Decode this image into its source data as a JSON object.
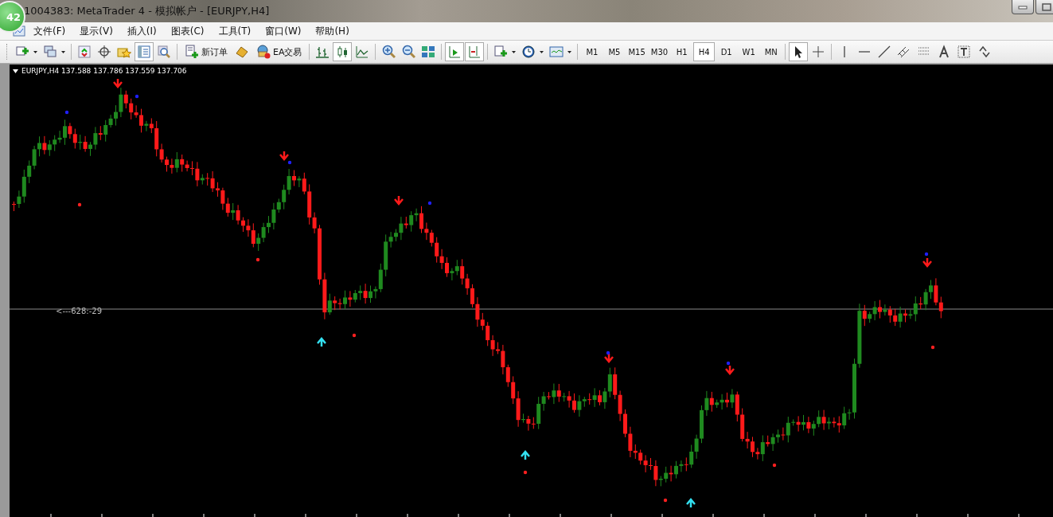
{
  "window": {
    "title": "1004383: MetaTrader 4 - 模拟帐户 - [EURJPY,H4]",
    "badge": "42"
  },
  "menu": [
    "文件(F)",
    "显示(V)",
    "插入(I)",
    "图表(C)",
    "工具(T)",
    "窗口(W)",
    "帮助(H)"
  ],
  "toolbar": [
    {
      "kind": "icon",
      "pressed": false
    },
    {
      "kind": "icon",
      "pressed": false
    },
    {
      "kind": "sep"
    },
    {
      "kind": "icon",
      "pressed": false
    },
    {
      "kind": "icon",
      "pressed": false
    },
    {
      "kind": "icon",
      "pressed": false
    },
    {
      "kind": "icon",
      "pressed": true
    },
    {
      "kind": "icon",
      "pressed": false
    },
    {
      "kind": "sep"
    },
    {
      "kind": "labeled",
      "label": "新订单"
    },
    {
      "kind": "icon",
      "pressed": false
    },
    {
      "kind": "labeled",
      "label": "EA交易"
    },
    {
      "kind": "sep"
    },
    {
      "kind": "icon",
      "pressed": false
    },
    {
      "kind": "icon",
      "pressed": true
    },
    {
      "kind": "icon",
      "pressed": false
    },
    {
      "kind": "sep"
    },
    {
      "kind": "icon",
      "pressed": false
    },
    {
      "kind": "icon",
      "pressed": false
    },
    {
      "kind": "icon",
      "pressed": false
    },
    {
      "kind": "sep"
    },
    {
      "kind": "icon",
      "pressed": true
    },
    {
      "kind": "icon",
      "pressed": true
    },
    {
      "kind": "sep"
    },
    {
      "kind": "icon",
      "pressed": false
    },
    {
      "kind": "icon",
      "pressed": false
    },
    {
      "kind": "icon",
      "pressed": false
    },
    {
      "kind": "sep"
    },
    {
      "kind": "timeframe",
      "label": "M1",
      "selected": false
    },
    {
      "kind": "timeframe",
      "label": "M5",
      "selected": false
    },
    {
      "kind": "timeframe",
      "label": "M15",
      "selected": false
    },
    {
      "kind": "timeframe",
      "label": "M30",
      "selected": false
    },
    {
      "kind": "timeframe",
      "label": "H1",
      "selected": false
    },
    {
      "kind": "timeframe",
      "label": "H4",
      "selected": true
    },
    {
      "kind": "timeframe",
      "label": "D1",
      "selected": false
    },
    {
      "kind": "timeframe",
      "label": "W1",
      "selected": false
    },
    {
      "kind": "timeframe",
      "label": "MN",
      "selected": false
    },
    {
      "kind": "sep"
    },
    {
      "kind": "icon",
      "pressed": true
    },
    {
      "kind": "icon",
      "pressed": false
    },
    {
      "kind": "sep"
    },
    {
      "kind": "icon",
      "pressed": false
    },
    {
      "kind": "icon",
      "pressed": false
    },
    {
      "kind": "icon",
      "pressed": false
    },
    {
      "kind": "icon",
      "pressed": false
    },
    {
      "kind": "icon",
      "pressed": false
    },
    {
      "kind": "icon",
      "pressed": false
    },
    {
      "kind": "icon",
      "pressed": false
    },
    {
      "kind": "icon",
      "pressed": false
    }
  ],
  "chart": {
    "header": "EURJPY,H4 137.588 137.786 137.559 137.706",
    "line_label": "<---628:-29"
  }
}
